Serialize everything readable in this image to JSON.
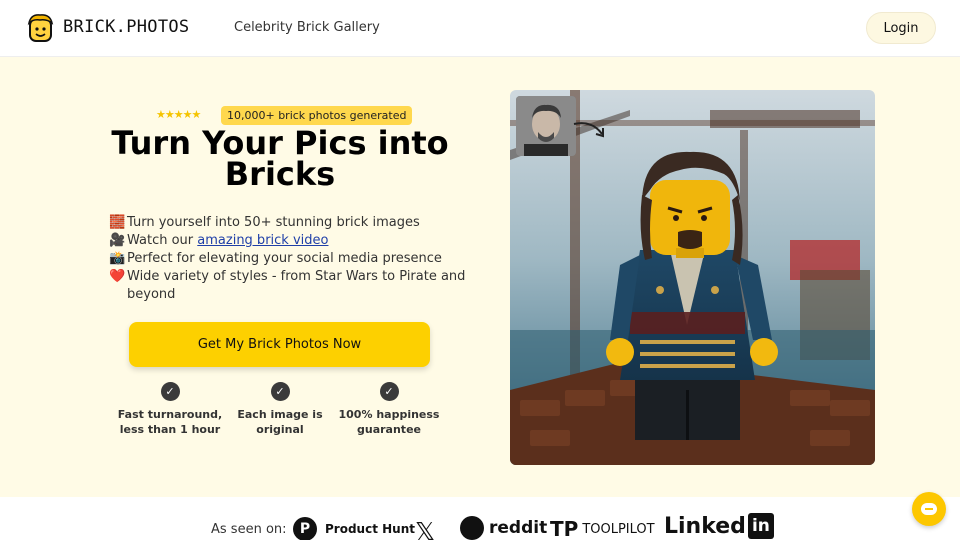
{
  "header": {
    "brand": "BRICK.PHOTOS",
    "nav_link": "Celebrity Brick Gallery",
    "login": "Login"
  },
  "hero": {
    "stars": "★★★★★",
    "rating": 5,
    "badge": "10,000+ brick photos generated",
    "title_line1": "Turn Your Pics into",
    "title_line2": "Bricks",
    "bullets": [
      {
        "icon": "brick-icon",
        "emoji": "🧱",
        "text": "Turn yourself into 50+ stunning brick images"
      },
      {
        "icon": "video-camera-icon",
        "emoji": "🎥",
        "text_before": "Watch our ",
        "link": "amazing brick video"
      },
      {
        "icon": "camera-icon",
        "emoji": "📸",
        "text": "Perfect for elevating your social media presence"
      },
      {
        "icon": "heart-icon",
        "emoji": "❤️",
        "text": "Wide variety of styles - from Star Wars to Pirate and beyond"
      }
    ],
    "cta": "Get My Brick Photos Now",
    "features": [
      {
        "text": "Fast turnaround, less than 1 hour"
      },
      {
        "text": "Each image is original"
      },
      {
        "text": "100% happiness guarantee"
      }
    ]
  },
  "seen_on": {
    "label": "As seen on:",
    "producthunt": "Product Hunt",
    "ph_letter": "P",
    "x": "𝕏",
    "reddit": "reddit",
    "toolpilot": "TOOLPILOT",
    "toolpilot_mark": "TP",
    "linkedin": "Linked",
    "linkedin_box": "in"
  },
  "colors": {
    "accent": "#fdd000",
    "background": "#fffbe6",
    "link": "#1f3fa8"
  }
}
